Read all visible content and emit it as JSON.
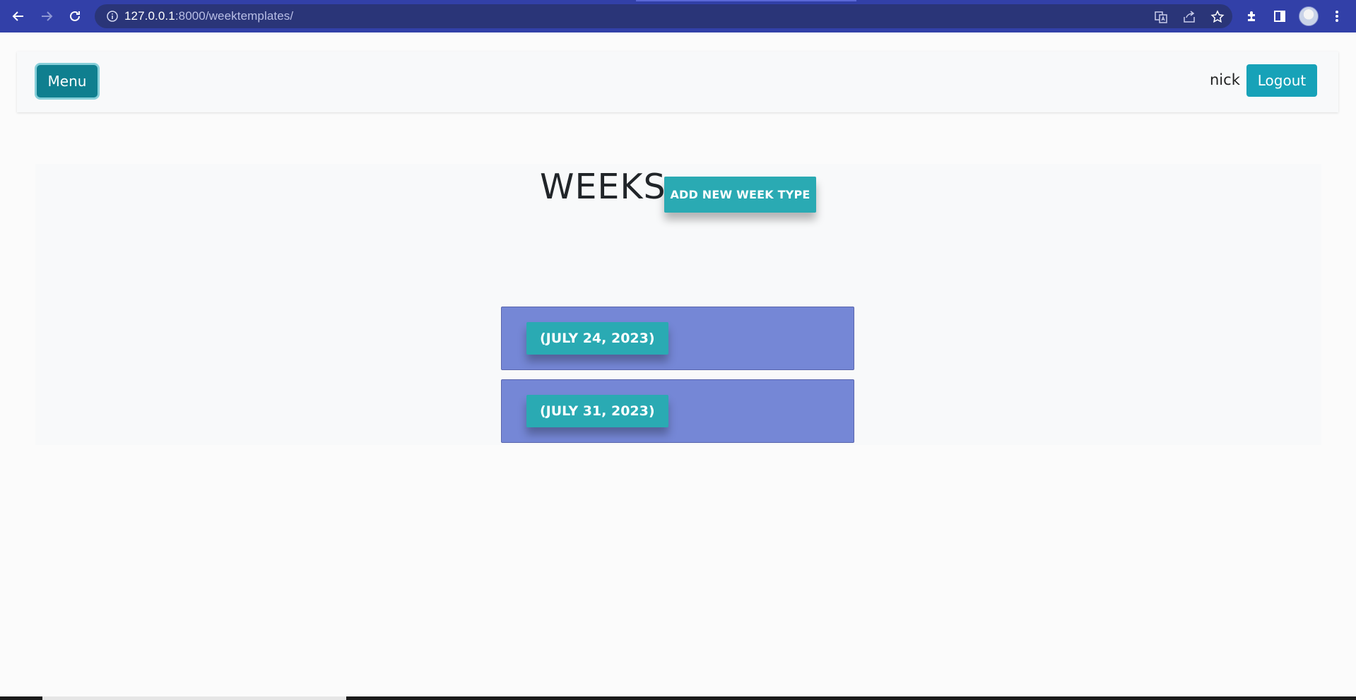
{
  "browser": {
    "url_host": "127.0.0.1",
    "url_path": ":8000/weektemplates/",
    "back_icon": "arrow-left-icon",
    "forward_icon": "arrow-right-icon",
    "reload_icon": "reload-icon"
  },
  "navbar": {
    "menu_label": "Menu",
    "username": "nick",
    "logout_label": "Logout"
  },
  "main": {
    "title": "WEEKS",
    "add_button_label": "ADD NEW WEEK TYPE",
    "weeks": [
      {
        "label": "(JULY 24, 2023)"
      },
      {
        "label": "(JULY 31, 2023)"
      }
    ]
  },
  "colors": {
    "browser_bar": "#3240a8",
    "accent_teal": "#2aaab3",
    "card_blue": "#7587d6",
    "menu_button": "#0f7f8f",
    "logout_button": "#17a2b8"
  }
}
